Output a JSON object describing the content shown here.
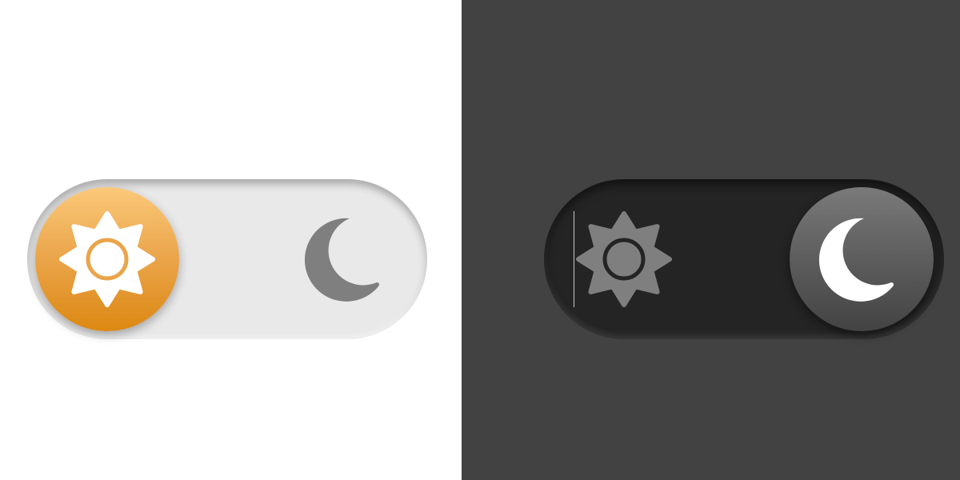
{
  "colors": {
    "light_background": "#ffffff",
    "dark_background": "#424242",
    "light_track": "#e9e9e9",
    "dark_track": "#242424",
    "sun_knob_accent": "#eaa449",
    "moon_knob_accent": "#5d5d5d",
    "active_icon": "#ffffff",
    "inactive_icon": "#7f7f7f"
  },
  "toggles": [
    {
      "theme": "light",
      "state": "light-mode",
      "active_icon": "sun-icon",
      "inactive_icon": "moon-icon"
    },
    {
      "theme": "dark",
      "state": "dark-mode",
      "active_icon": "moon-icon",
      "inactive_icon": "sun-icon"
    }
  ]
}
